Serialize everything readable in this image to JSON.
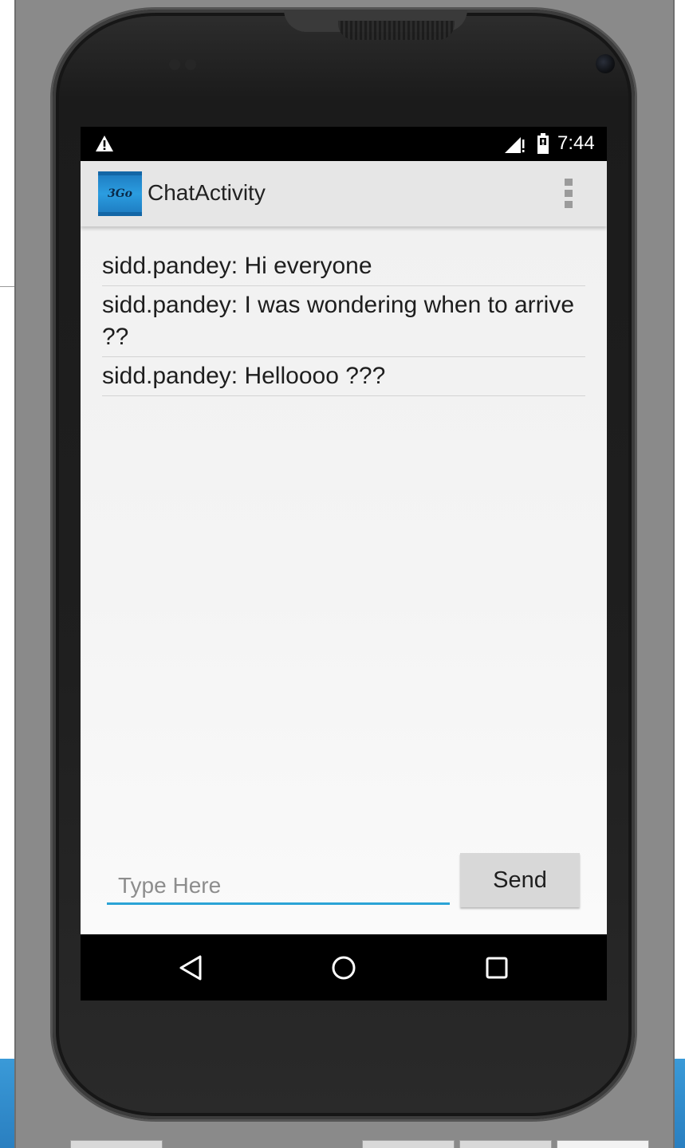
{
  "status_bar": {
    "time": "7:44",
    "icons": [
      "warning-icon",
      "signal-icon",
      "battery-icon"
    ]
  },
  "action_bar": {
    "logo_text": "3Go",
    "title": "ChatActivity",
    "menu_icon": "overflow-menu-icon"
  },
  "messages": [
    "sidd.pandey: Hi everyone",
    "sidd.pandey: I was wondering when to arrive ??",
    "sidd.pandey: Helloooo ???"
  ],
  "composer": {
    "placeholder": "Type Here",
    "value": "",
    "send_label": "Send"
  },
  "nav_bar": {
    "icons": [
      "back-icon",
      "home-icon",
      "recents-icon"
    ]
  },
  "colors": {
    "accent": "#2aa3d6",
    "action_bar": "#e6e6e6",
    "logo_blue": "#2b9de0"
  }
}
